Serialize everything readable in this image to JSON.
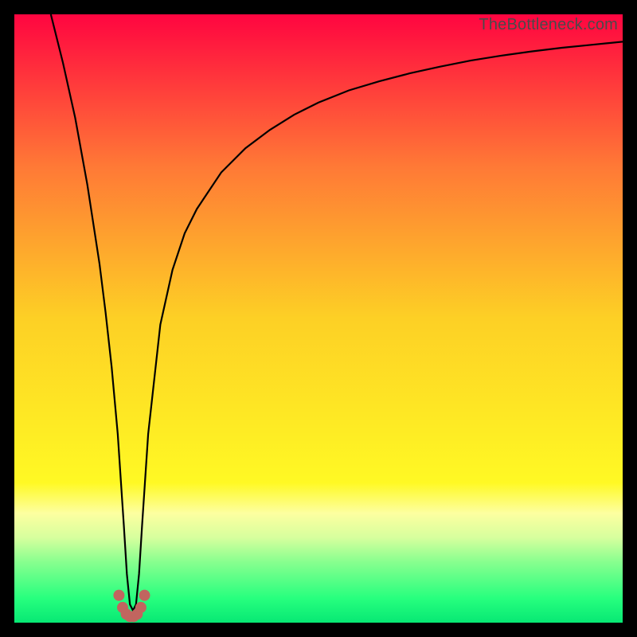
{
  "watermark": "TheBottleneck.com",
  "chart_data": {
    "type": "line",
    "title": "",
    "xlabel": "",
    "ylabel": "",
    "xlim": [
      0,
      100
    ],
    "ylim": [
      0,
      100
    ],
    "grid": false,
    "legend": false,
    "background_gradient": {
      "stops": [
        {
          "pos": 0.0,
          "color": "#ff0540"
        },
        {
          "pos": 0.25,
          "color": "#ff7936"
        },
        {
          "pos": 0.5,
          "color": "#fdd025"
        },
        {
          "pos": 0.77,
          "color": "#fff924"
        },
        {
          "pos": 0.82,
          "color": "#fdffa0"
        },
        {
          "pos": 0.86,
          "color": "#d7ff9e"
        },
        {
          "pos": 0.9,
          "color": "#88ff8f"
        },
        {
          "pos": 0.96,
          "color": "#27ff7e"
        },
        {
          "pos": 1.0,
          "color": "#07e874"
        }
      ]
    },
    "series": [
      {
        "name": "bottleneck-curve",
        "color": "#000000",
        "width": 2.2,
        "x": [
          6,
          8,
          10,
          12,
          14,
          15,
          16,
          17,
          18,
          18.5,
          19,
          19.5,
          20,
          20.5,
          21,
          22,
          24,
          26,
          28,
          30,
          34,
          38,
          42,
          46,
          50,
          55,
          60,
          65,
          70,
          75,
          80,
          85,
          90,
          95,
          100
        ],
        "y": [
          100,
          92,
          83,
          72,
          59,
          51,
          42,
          31,
          16,
          8,
          3,
          2,
          3,
          8,
          16,
          31,
          49,
          58,
          64,
          68,
          74,
          78,
          81,
          83.5,
          85.5,
          87.5,
          89,
          90.3,
          91.4,
          92.4,
          93.2,
          93.9,
          94.5,
          95,
          95.5
        ]
      }
    ],
    "markers": {
      "name": "valley-cluster",
      "color": "#c1655f",
      "radius": 7,
      "points": [
        {
          "x": 17.2,
          "y": 4.5
        },
        {
          "x": 17.8,
          "y": 2.5
        },
        {
          "x": 18.4,
          "y": 1.4
        },
        {
          "x": 19.0,
          "y": 1.0
        },
        {
          "x": 19.6,
          "y": 1.0
        },
        {
          "x": 20.2,
          "y": 1.4
        },
        {
          "x": 20.8,
          "y": 2.5
        },
        {
          "x": 21.4,
          "y": 4.5
        }
      ]
    }
  }
}
